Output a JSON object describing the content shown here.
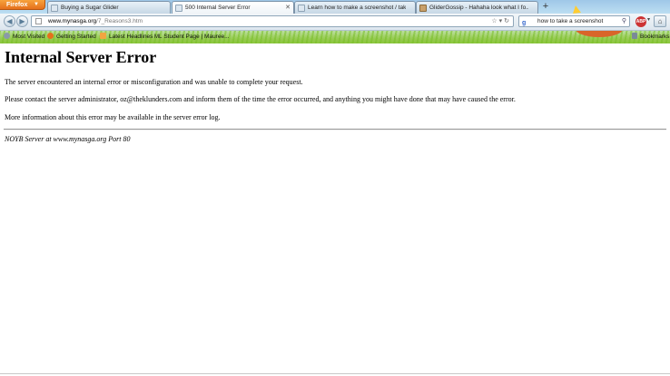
{
  "browser": {
    "app_button": "Firefox",
    "tabs": [
      {
        "label": "Buying a Sugar Glider",
        "active": false
      },
      {
        "label": "500 Internal Server Error",
        "active": true
      },
      {
        "label": "Learn how to make a screenshot / tak...",
        "active": false
      },
      {
        "label": "GliderGossip - Hahaha look what I fo...",
        "active": false
      }
    ],
    "new_tab": "+",
    "url": {
      "domain": "www.mynasga.org",
      "path": "/7_Reasons3.htm"
    },
    "search_value": "how to take a screenshot",
    "abp_label": "ABP",
    "bookmarks": [
      {
        "label": "Most Visited",
        "icon": "gear-icon"
      },
      {
        "label": "Getting Started",
        "icon": "firefox-icon"
      },
      {
        "label": "Latest Headlines",
        "icon": "rss-icon"
      },
      {
        "label": "Student Page | Mauree...",
        "icon": "ml-icon",
        "prefix": "ML"
      }
    ],
    "bookmarks_menu": "Bookmarks"
  },
  "page": {
    "heading": "Internal Server Error",
    "paragraph1": "The server encountered an internal error or misconfiguration and was unable to complete your request.",
    "paragraph2": "Please contact the server administrator, oz@theklunders.com and inform them of the time the error occurred, and anything you might have done that may have caused the error.",
    "paragraph3": "More information about this error may be available in the server error log.",
    "server_signature": "NOYB Server at www.mynasga.org Port 80"
  },
  "colors": {
    "firefox_button": "#e5711c",
    "theme_sky": "#b9dcf1",
    "theme_grass": "#8cc63f"
  }
}
